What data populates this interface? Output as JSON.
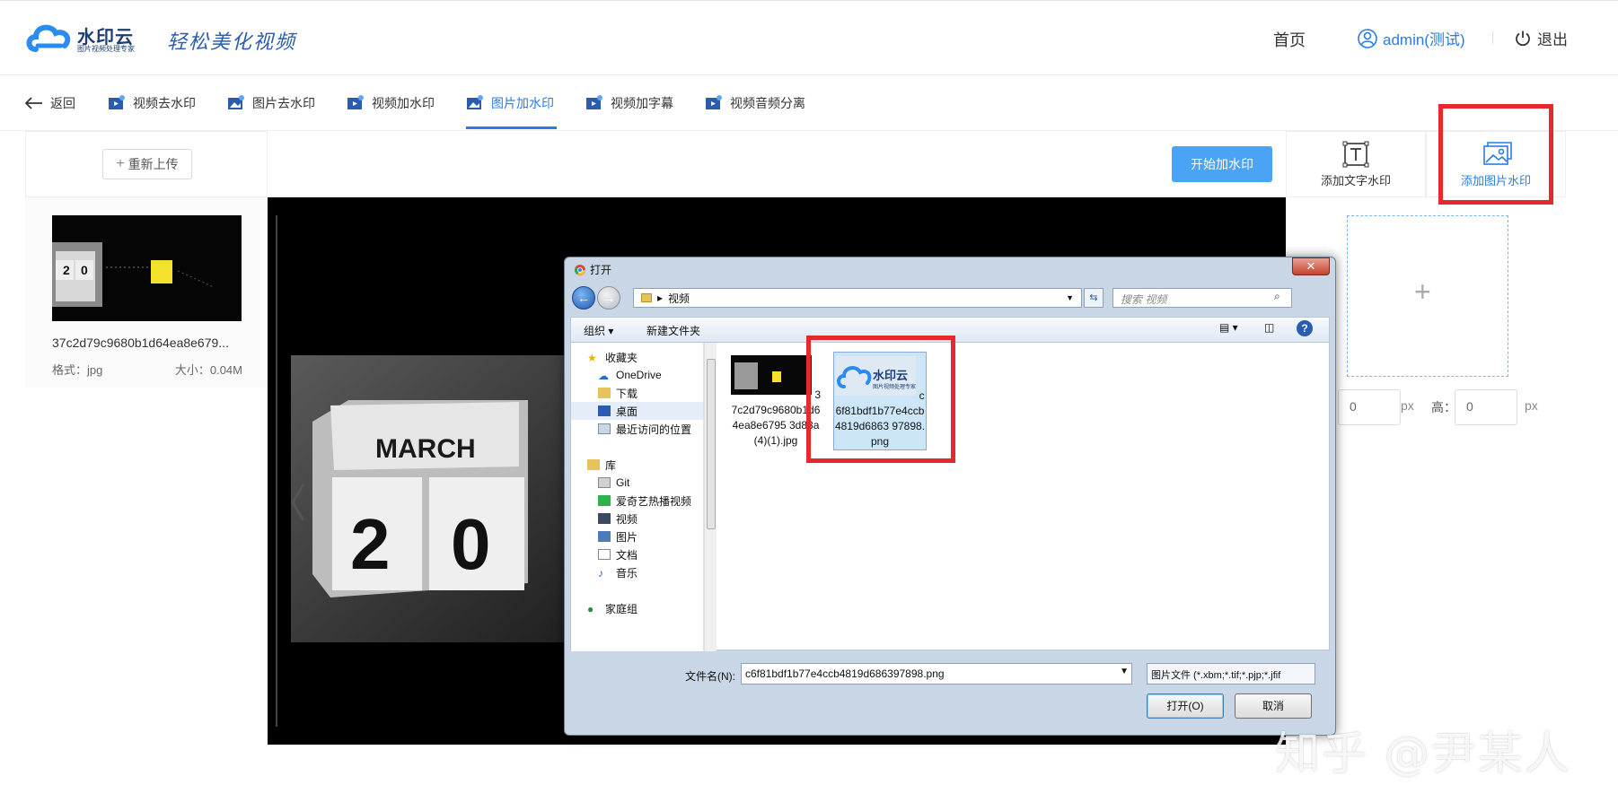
{
  "header": {
    "logo_name": "水印云",
    "logo_sub": "图片视频处理专家",
    "slogan": "轻松美化视频",
    "home": "首页",
    "user": "admin(测试)",
    "logout": "退出"
  },
  "toolbar": {
    "back": "返回",
    "items": [
      "视频去水印",
      "图片去水印",
      "视频加水印",
      "图片加水印",
      "视频加字幕",
      "视频音频分离"
    ],
    "active_index": 3
  },
  "left": {
    "reupload": "重新上传",
    "file_name": "37c2d79c9680b1d64ea8e679...",
    "format": "格式：jpg",
    "size": "大小：0.04M"
  },
  "work": {
    "start": "开始加水印"
  },
  "right": {
    "text_wm": "添加文字水印",
    "image_wm": "添加图片水印",
    "width_val": "0",
    "height_label": "高：",
    "height_val": "0",
    "unit": "px"
  },
  "dialog": {
    "title": "打开",
    "address": "视频",
    "search_placeholder": "搜索 视频",
    "organize": "组织 ▾",
    "new_folder": "新建文件夹",
    "tree": {
      "favorites": "收藏夹",
      "onedrive": "OneDrive",
      "downloads": "下载",
      "desktop": "桌面",
      "recent": "最近访问的位置",
      "library": "库",
      "git": "Git",
      "iqiyi": "爱奇艺热播视频",
      "videos": "视频",
      "pictures": "图片",
      "docs": "文档",
      "music": "音乐",
      "homegroup": "家庭组"
    },
    "files": [
      {
        "name": "37c2d79c9680b1d64ea8e6795 3d88a (4)(1).jpg"
      },
      {
        "name": "c6f81bdf1b77e4ccb4819d6863 97898.png"
      }
    ],
    "file_logo_text": "水印云",
    "file_logo_sub": "图片视频处理专家",
    "filename_label": "文件名(N):",
    "filename_value": "c6f81bdf1b77e4ccb4819d686397898.png",
    "filetype": "图片文件 (*.xbm;*.tif;*.pjp;*.jfif",
    "open": "打开(O)",
    "cancel": "取消"
  },
  "stage": {
    "calendar_month": "MARCH",
    "calendar_d1": "2",
    "calendar_d2": "0"
  },
  "watermark": "知乎 @尹某人",
  "colors": {
    "accent": "#2a7be4",
    "highlight": "#e8282f"
  }
}
